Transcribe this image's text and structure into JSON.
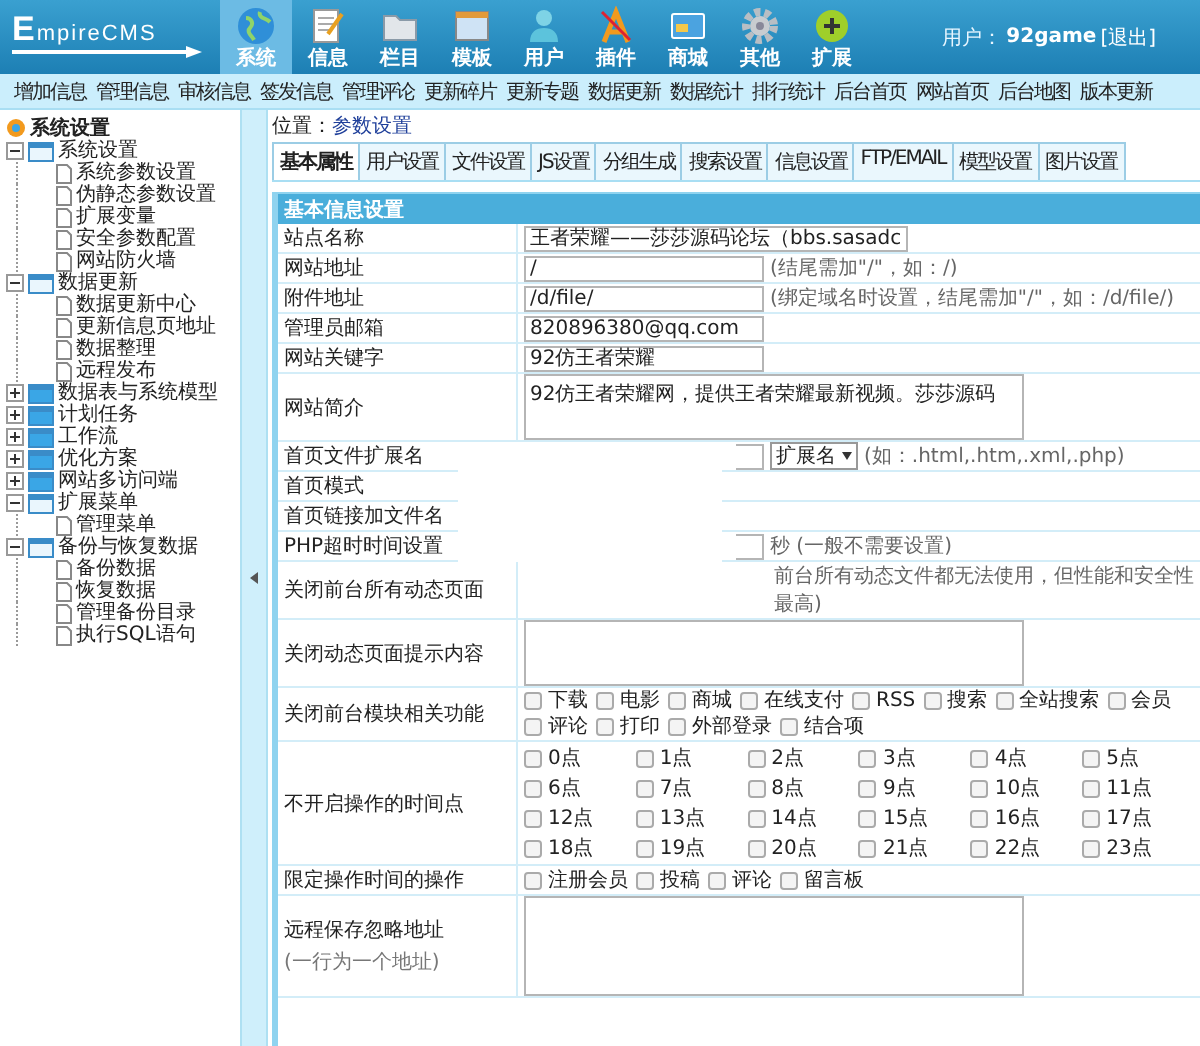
{
  "header": {
    "logo": "EmpireCMS",
    "nav": [
      {
        "label": "系统",
        "selected": true
      },
      {
        "label": "信息",
        "selected": false
      },
      {
        "label": "栏目",
        "selected": false
      },
      {
        "label": "模板",
        "selected": false
      },
      {
        "label": "用户",
        "selected": false
      },
      {
        "label": "插件",
        "selected": false
      },
      {
        "label": "商城",
        "selected": false
      },
      {
        "label": "其他",
        "selected": false
      },
      {
        "label": "扩展",
        "selected": false
      }
    ],
    "user_label": "用户：",
    "user_name": "92game",
    "logout": "[退出]"
  },
  "subnav": [
    "增加信息",
    "管理信息",
    "审核信息",
    "签发信息",
    "管理评论",
    "更新碎片",
    "更新专题",
    "数据更新",
    "数据统计",
    "排行统计",
    "后台首页",
    "网站首页",
    "后台地图",
    "版本更新"
  ],
  "sidebar": {
    "title": "系统设置",
    "items": [
      {
        "label": "系统设置",
        "expanded": true,
        "children": [
          {
            "label": "系统参数设置"
          },
          {
            "label": "伪静态参数设置"
          },
          {
            "label": "扩展变量"
          },
          {
            "label": "安全参数配置"
          },
          {
            "label": "网站防火墙"
          }
        ]
      },
      {
        "label": "数据更新",
        "expanded": true,
        "children": [
          {
            "label": "数据更新中心"
          },
          {
            "label": "更新信息页地址"
          },
          {
            "label": "数据整理"
          },
          {
            "label": "远程发布"
          }
        ]
      },
      {
        "label": "数据表与系统模型",
        "expanded": false
      },
      {
        "label": "计划任务",
        "expanded": false
      },
      {
        "label": "工作流",
        "expanded": false
      },
      {
        "label": "优化方案",
        "expanded": false
      },
      {
        "label": "网站多访问端",
        "expanded": false
      },
      {
        "label": "扩展菜单",
        "expanded": true,
        "children": [
          {
            "label": "管理菜单"
          }
        ]
      },
      {
        "label": "备份与恢复数据",
        "expanded": true,
        "children": [
          {
            "label": "备份数据"
          },
          {
            "label": "恢复数据"
          },
          {
            "label": "管理备份目录"
          },
          {
            "label": "执行SQL语句"
          }
        ]
      }
    ]
  },
  "breadcrumb": {
    "label": "位置：",
    "link": "参数设置"
  },
  "tabs": [
    {
      "label": "基本属性",
      "selected": true
    },
    {
      "label": "用户设置",
      "selected": false
    },
    {
      "label": "文件设置",
      "selected": false
    },
    {
      "label": "JS设置",
      "selected": false
    },
    {
      "label": "分组生成",
      "selected": false
    },
    {
      "label": "搜索设置",
      "selected": false
    },
    {
      "label": "信息设置",
      "selected": false
    },
    {
      "label": "FTP/EMAIL",
      "selected": false
    },
    {
      "label": "模型设置",
      "selected": false
    },
    {
      "label": "图片设置",
      "selected": false
    }
  ],
  "section_title": "基本信息设置",
  "rows": [
    {
      "kind": "text",
      "label": "站点名称",
      "value": "王者荣耀——莎莎源码论坛（bbs.sasadc"
    },
    {
      "kind": "text",
      "label": "网站地址",
      "value": "/",
      "hint": "(结尾需加\"/\"，如：/)"
    },
    {
      "kind": "text",
      "label": "附件地址",
      "value": "/d/file/",
      "hint": "(绑定域名时设置，结尾需加\"/\"，如：/d/file/)"
    },
    {
      "kind": "text",
      "label": "管理员邮箱",
      "value": "820896380@qq.com"
    },
    {
      "kind": "text",
      "label": "网站关键字",
      "value": "92仿王者荣耀"
    },
    {
      "kind": "textarea",
      "label": "网站简介",
      "value": "92仿王者荣耀网，提供王者荣耀最新视频。莎莎源码"
    },
    {
      "kind": "extension",
      "label": "首页文件扩展名",
      "select": "扩展名",
      "hint": "(如：.html,.htm,.xml,.php)"
    },
    {
      "kind": "plain",
      "label": "首页模式"
    },
    {
      "kind": "plain",
      "label": "首页链接加文件名"
    },
    {
      "kind": "text",
      "label": "PHP超时时间设置",
      "value": "",
      "hint": "秒 (一般不需要设置)"
    },
    {
      "kind": "note",
      "label": "关闭前台所有动态页面",
      "hint": "前台所有动态文件都无法使用，但性能和安全性最高)"
    },
    {
      "kind": "textarea",
      "label": "关闭动态页面提示内容"
    },
    {
      "kind": "checks",
      "label": "关闭前台模块相关功能",
      "options": [
        {
          "label": "下载",
          "checked": false
        },
        {
          "label": "电影",
          "checked": false
        },
        {
          "label": "商城",
          "checked": false
        },
        {
          "label": "在线支付",
          "checked": false
        },
        {
          "label": "RSS",
          "checked": false
        },
        {
          "label": "搜索",
          "checked": false
        },
        {
          "label": "全站搜索",
          "checked": false
        },
        {
          "label": "会员",
          "checked": false
        },
        {
          "label": "评论",
          "checked": false
        },
        {
          "label": "打印",
          "checked": false
        },
        {
          "label": "外部登录",
          "checked": false
        },
        {
          "label": "结合项",
          "checked": false
        }
      ]
    },
    {
      "kind": "hours",
      "label": "不开启操作的时间点",
      "options": [
        {
          "label": "0点",
          "checked": false
        },
        {
          "label": "1点",
          "checked": false
        },
        {
          "label": "2点",
          "checked": false
        },
        {
          "label": "3点",
          "checked": false
        },
        {
          "label": "4点",
          "checked": false
        },
        {
          "label": "5点",
          "checked": false
        },
        {
          "label": "6点",
          "checked": false
        },
        {
          "label": "7点",
          "checked": false
        },
        {
          "label": "8点",
          "checked": false
        },
        {
          "label": "9点",
          "checked": false
        },
        {
          "label": "10点",
          "checked": false
        },
        {
          "label": "11点",
          "checked": false
        },
        {
          "label": "12点",
          "checked": false
        },
        {
          "label": "13点",
          "checked": false
        },
        {
          "label": "14点",
          "checked": false
        },
        {
          "label": "15点",
          "checked": false
        },
        {
          "label": "16点",
          "checked": false
        },
        {
          "label": "17点",
          "checked": false
        },
        {
          "label": "18点",
          "checked": false
        },
        {
          "label": "19点",
          "checked": false
        },
        {
          "label": "20点",
          "checked": false
        },
        {
          "label": "21点",
          "checked": false
        },
        {
          "label": "22点",
          "checked": false
        },
        {
          "label": "23点",
          "checked": false
        }
      ]
    },
    {
      "kind": "checks",
      "label": "限定操作时间的操作",
      "options": [
        {
          "label": "注册会员",
          "checked": false
        },
        {
          "label": "投稿",
          "checked": false
        },
        {
          "label": "评论",
          "checked": false
        },
        {
          "label": "留言板",
          "checked": false
        }
      ]
    },
    {
      "kind": "remote",
      "label": "远程保存忽略地址",
      "sublabel": "(一行为一个地址)"
    }
  ]
}
